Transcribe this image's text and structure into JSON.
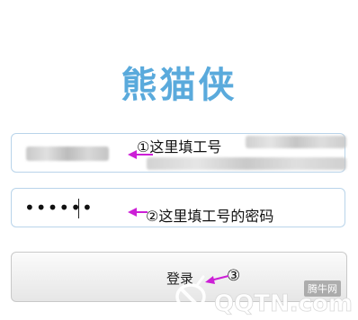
{
  "app": {
    "title": "熊猫侠"
  },
  "username": {
    "value_blurred": true,
    "annotation": "①这里填工号"
  },
  "password": {
    "masked_value": "••••••",
    "annotation": "②这里填工号的密码"
  },
  "login": {
    "label": "登录",
    "annotation": "③"
  },
  "watermark": {
    "brand": "QQTN.com",
    "badge": "腾牛网"
  },
  "colors": {
    "title": "#5aaadc",
    "field_border": "#b9d4ea",
    "annotation_arrow": "#cc1fd6",
    "watermark": "#ffffff"
  }
}
